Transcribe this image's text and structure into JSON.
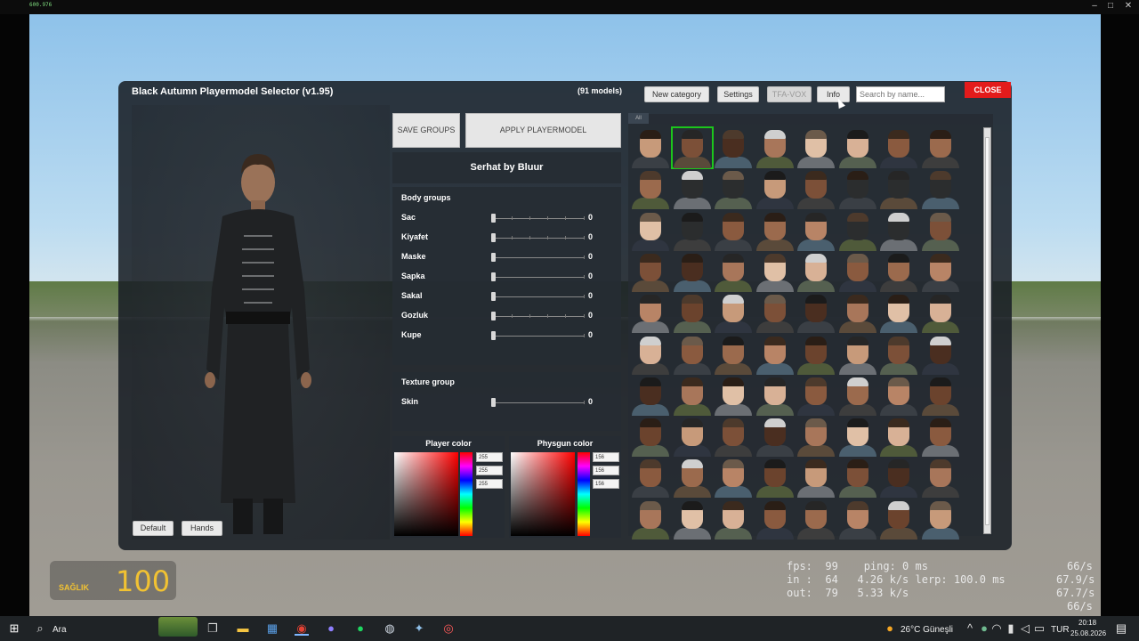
{
  "window": {
    "tag": "600.976",
    "min": "–",
    "max": "□",
    "close": "✕"
  },
  "panel": {
    "title": "Black Autumn Playermodel Selector (v1.95)",
    "model_count": "(91 models)",
    "top_buttons": [
      "New category",
      "Settings",
      "TFA-VOX",
      "Info"
    ],
    "search_placeholder": "Search by name...",
    "close": "CLOSE"
  },
  "preview": {
    "default_btn": "Default",
    "hands_btn": "Hands"
  },
  "actions": {
    "save_groups": "SAVE GROUPS",
    "apply": "APPLY PLAYERMODEL"
  },
  "model_name": "Serhat by Bluur",
  "bodygroups": {
    "title": "Body groups",
    "items": [
      {
        "label": "Sac",
        "value": "0"
      },
      {
        "label": "Kiyafet",
        "value": "0"
      },
      {
        "label": "Maske",
        "value": "0"
      },
      {
        "label": "Sapka",
        "value": "0"
      },
      {
        "label": "Sakal",
        "value": "0"
      },
      {
        "label": "Gozluk",
        "value": "0"
      },
      {
        "label": "Kupe",
        "value": "0"
      }
    ]
  },
  "texture": {
    "title": "Texture group",
    "items": [
      {
        "label": "Skin",
        "value": "0"
      }
    ]
  },
  "player_color": {
    "title": "Player color",
    "r": "255",
    "g": "255",
    "b": "255"
  },
  "physgun_color": {
    "title": "Physgun color",
    "r": "156",
    "g": "156",
    "b": "156"
  },
  "grid": {
    "tab": "All",
    "selected_index": 1
  },
  "hud": {
    "health_label": "SAĞLIK",
    "health_value": "100"
  },
  "netgraph": {
    "line1": "fps:  99    ping: 0 ms",
    "line2": "in :  64   4.26 k/s lerp: 100.0 ms",
    "line3": "out:  79   5.33 k/s",
    "right1": "66/s",
    "right2": "67.9/s",
    "right3": "67.7/s",
    "right4": "66/s"
  },
  "taskbar": {
    "search_label": "Ara",
    "weather": "26°C Güneşli",
    "lang": "TUR",
    "time": "20:18",
    "date": "25.08.2026"
  }
}
